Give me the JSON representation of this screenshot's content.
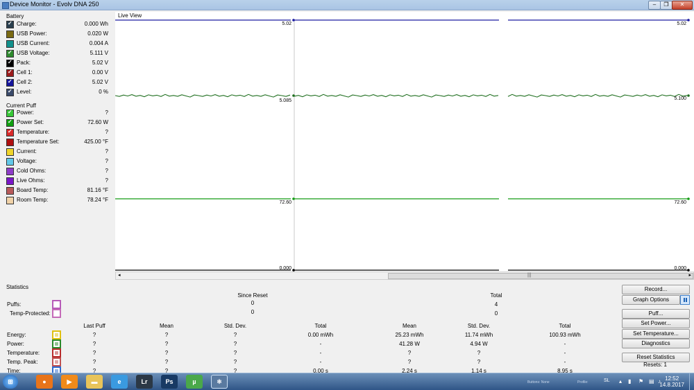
{
  "window": {
    "title": "Device Monitor - Evolv DNA 250",
    "min": "–",
    "max": "❐",
    "close": "✕"
  },
  "battery": {
    "title": "Battery",
    "rows": [
      {
        "label": "Charge:",
        "value": "0.000 Wh",
        "color": "#2a3f4e",
        "checked": true
      },
      {
        "label": "USB Power:",
        "value": "0.020 W",
        "color": "#7a6a12",
        "checked": false
      },
      {
        "label": "USB Current:",
        "value": "0.004 A",
        "color": "#12918c",
        "checked": false
      },
      {
        "label": "USB Voltage:",
        "value": "5.111 V",
        "color": "#2e8b2e",
        "checked": true
      },
      {
        "label": "Pack:",
        "value": "5.02 V",
        "color": "#000000",
        "checked": true
      },
      {
        "label": "Cell 1:",
        "value": "0.00 V",
        "color": "#9b1b1b",
        "checked": true
      },
      {
        "label": "Cell 2:",
        "value": "5.02 V",
        "color": "#14149b",
        "checked": true
      },
      {
        "label": "Level:",
        "value": "0 %",
        "color": "#3a4a6a",
        "checked": true
      }
    ]
  },
  "current_puff": {
    "title": "Current Puff",
    "rows": [
      {
        "label": "Power:",
        "value": "?",
        "color": "#37c837",
        "checked": true
      },
      {
        "label": "Power Set:",
        "value": "72.60 W",
        "color": "#11a011",
        "checked": true
      },
      {
        "label": "Temperature:",
        "value": "?",
        "color": "#d92a2a",
        "checked": true
      },
      {
        "label": "Temperature Set:",
        "value": "425.00 °F",
        "color": "#b01010",
        "checked": false
      },
      {
        "label": "Current:",
        "value": "?",
        "color": "#f0d52a",
        "checked": false
      },
      {
        "label": "Voltage:",
        "value": "?",
        "color": "#62c8e8",
        "checked": false
      },
      {
        "label": "Cold Ohms:",
        "value": "?",
        "color": "#8e3cc8",
        "checked": false
      },
      {
        "label": "Live Ohms:",
        "value": "?",
        "color": "#7a16c8",
        "checked": false
      },
      {
        "label": "Board Temp:",
        "value": "81.16 °F",
        "color": "#b85a5a",
        "checked": false
      },
      {
        "label": "Room Temp:",
        "value": "78.24 °F",
        "color": "#f0d2a8",
        "checked": false
      }
    ]
  },
  "live_view": {
    "title": "Live View",
    "labels": {
      "pack_left": "5.02",
      "pack_right": "5.02",
      "usb_left": "5.085",
      "usb_right": "5.100",
      "power_left": "72.60",
      "power_right": "72.60",
      "zero_left": "0.000",
      "zero_right": "0.000"
    },
    "colors": {
      "pack": "#1a1aa0",
      "usb": "#1e6e1e",
      "power": "#139b13",
      "zero": "#000000"
    }
  },
  "chart_data": {
    "type": "line",
    "title": "Live View",
    "series": [
      {
        "color": "#1a1aa0",
        "values": [
          5.02,
          5.02,
          5.02,
          5.02,
          5.02,
          5.02,
          5.02,
          5.02,
          5.02,
          5.02
        ]
      },
      {
        "color": "#1e6e1e",
        "values": [
          5.085,
          5.09,
          5.08,
          5.095,
          5.085,
          5.09,
          5.1,
          5.085,
          5.095,
          5.1
        ]
      },
      {
        "color": "#139b13",
        "values": [
          72.6,
          72.6,
          72.6,
          72.6,
          72.6,
          72.6,
          72.6,
          72.6,
          72.6,
          72.6
        ]
      }
    ]
  },
  "statistics": {
    "title": "Statistics",
    "since_reset": "Since Reset",
    "total": "Total",
    "puffs": {
      "label": "Puffs:",
      "since": "0",
      "total": "4",
      "color": "#b65ab8"
    },
    "temp_protected": {
      "label": "Temp-Protected:",
      "since": "0",
      "total": "0",
      "color": "#c46ab8"
    },
    "columns": [
      "Last Puff",
      "Mean",
      "Std. Dev.",
      "Total",
      "Mean",
      "Std. Dev.",
      "Total"
    ],
    "rows": [
      {
        "label": "Energy:",
        "color": "#e0c010",
        "cells": [
          "?",
          "?",
          "?",
          "0.00 mWh",
          "25.23 mWh",
          "11.74 mWh",
          "100.93 mWh"
        ]
      },
      {
        "label": "Power:",
        "color": "#2a8a2a",
        "cells": [
          "?",
          "?",
          "?",
          "-",
          "41.28 W",
          "4.94 W",
          "-"
        ]
      },
      {
        "label": "Temperature:",
        "color": "#b82a2a",
        "cells": [
          "?",
          "?",
          "?",
          "-",
          "?",
          "?",
          "-"
        ]
      },
      {
        "label": "Temp. Peak:",
        "color": "#c05050",
        "cells": [
          "?",
          "?",
          "?",
          "-",
          "?",
          "?",
          "-"
        ]
      },
      {
        "label": "Time:",
        "color": "#2a6ad0",
        "cells": [
          "?",
          "?",
          "?",
          "0.00 s",
          "2.24 s",
          "1.14 s",
          "8.95 s"
        ]
      }
    ]
  },
  "buttons": {
    "record": "Record...",
    "graph_options": "Graph Options",
    "puff": "Puff...",
    "set_power": "Set Power...",
    "set_temperature": "Set Temperature...",
    "diagnostics": "Diagnostics",
    "reset_statistics": "Reset Statistics",
    "resets": "Resets: 1"
  },
  "taskbar": {
    "apps": [
      {
        "name": "firefox-icon",
        "glyph": "●",
        "color": "#e8741a"
      },
      {
        "name": "media-player-icon",
        "glyph": "▶",
        "color": "#f08a1a"
      },
      {
        "name": "folder-icon",
        "glyph": "▬",
        "color": "#e8c45a"
      },
      {
        "name": "ie-icon",
        "glyph": "e",
        "color": "#3a9ae0"
      },
      {
        "name": "lightroom-icon",
        "glyph": "Lr",
        "color": "#2b3846"
      },
      {
        "name": "photoshop-icon",
        "glyph": "Ps",
        "color": "#183a64"
      },
      {
        "name": "utorrent-icon",
        "glyph": "µ",
        "color": "#4aa84a"
      },
      {
        "name": "device-monitor-icon",
        "glyph": "⚛",
        "color": "#5a7aa0"
      }
    ],
    "ghost_buttons": "Buttons: None",
    "ghost_profile": "Profile:",
    "lang": "SL",
    "time": "12:52",
    "date": "14.8.2017"
  }
}
